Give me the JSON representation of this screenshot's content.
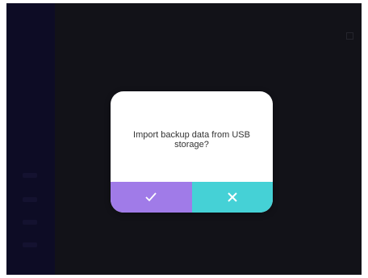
{
  "dialog": {
    "message": "Import backup data from USB storage?",
    "confirm_icon": "check-icon",
    "cancel_icon": "close-icon"
  },
  "colors": {
    "confirm": "#a07be8",
    "cancel": "#45d1d6",
    "screen_bg": "#1d1d25",
    "sidebar_bg": "#15133a"
  }
}
